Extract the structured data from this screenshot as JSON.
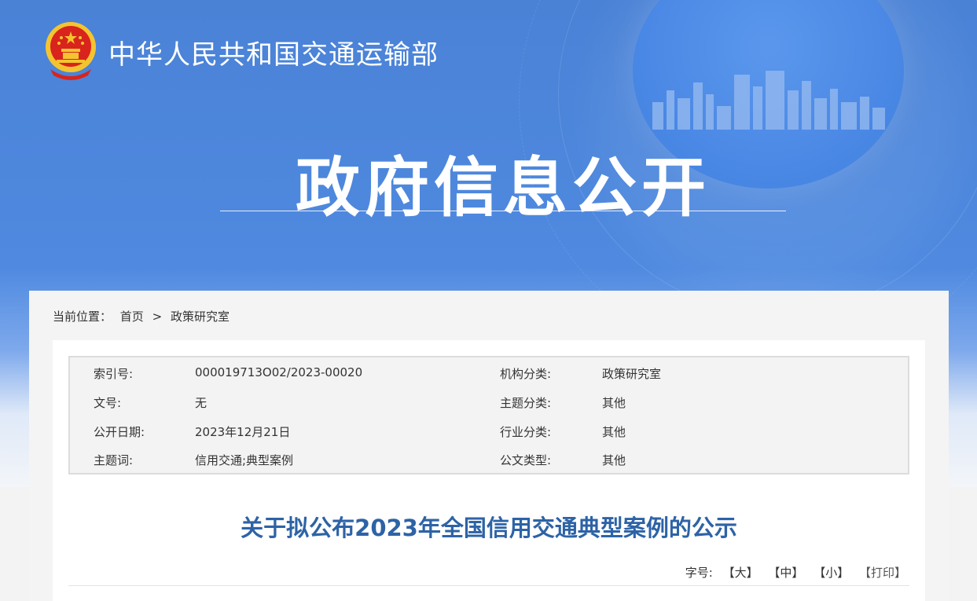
{
  "header": {
    "site_name": "中华人民共和国交通运输部",
    "banner_title": "政府信息公开"
  },
  "breadcrumb": {
    "label": "当前位置：",
    "home": "首页",
    "separator": ">",
    "current": "政策研究室"
  },
  "meta": {
    "index_no_label": "索引号:",
    "index_no_value": "000019713O02/2023-00020",
    "org_label": "机构分类:",
    "org_value": "政策研究室",
    "doc_no_label": "文号:",
    "doc_no_value": "无",
    "topic_cat_label": "主题分类:",
    "topic_cat_value": "其他",
    "date_label": "公开日期:",
    "date_value": "2023年12月21日",
    "industry_label": "行业分类:",
    "industry_value": "其他",
    "keywords_label": "主题词:",
    "keywords_value": "信用交通;典型案例",
    "doc_type_label": "公文类型:",
    "doc_type_value": "其他"
  },
  "article": {
    "title": "关于拟公布2023年全国信用交通典型案例的公示"
  },
  "tools": {
    "font_label": "字号:",
    "large": "【大】",
    "medium": "【中】",
    "small": "【小】",
    "print": "【打印】"
  },
  "colors": {
    "banner_blue": "#4a82d6",
    "title_blue": "#2d63a6",
    "emblem_red": "#d8241c",
    "emblem_gold": "#f4c430"
  }
}
